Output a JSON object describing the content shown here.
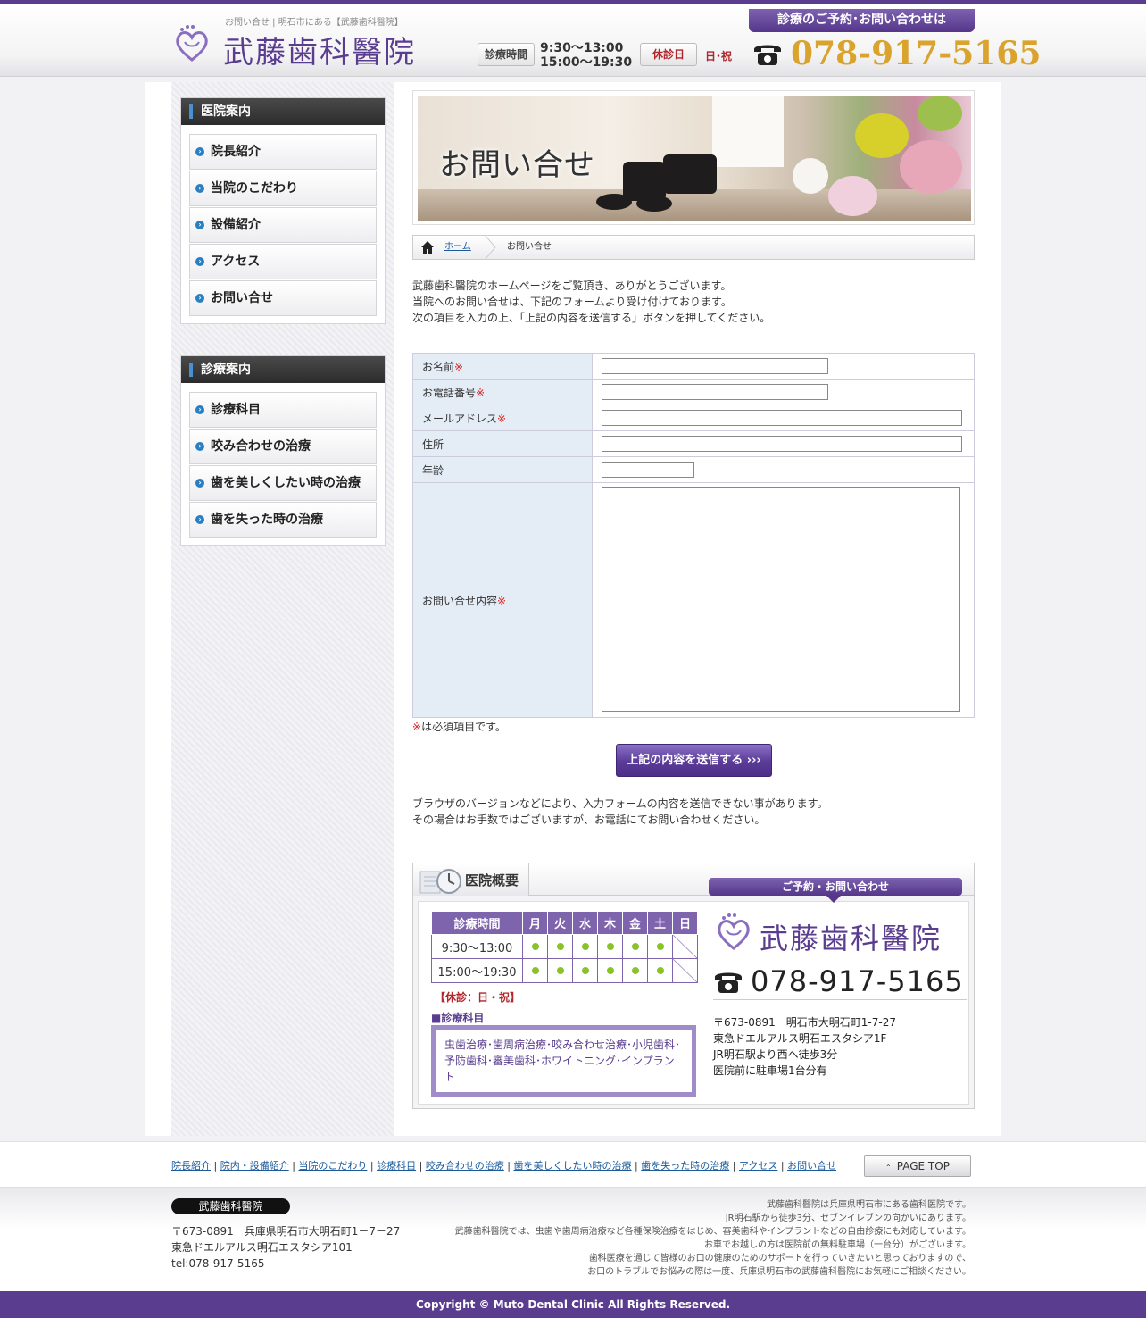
{
  "header": {
    "tagline": "お問い合せ | 明石市にある【武藤歯科醫院】",
    "logo_text": "武藤歯科醫院",
    "hours_label": "診療時間",
    "hours_am": "9:30～13:00",
    "hours_pm": "15:00～19:30",
    "closed_label": "休診日",
    "closed_days": "日･祝",
    "contact_banner": "診療のご予約･お問い合わせは",
    "phone": "078-917-5165"
  },
  "sidebar": {
    "clinic_head": "医院案内",
    "clinic_items": [
      "院長紹介",
      "当院のこだわり",
      "設備紹介",
      "アクセス",
      "お問い合せ"
    ],
    "treat_head": "診療案内",
    "treat_items": [
      "診療科目",
      "咬み合わせの治療",
      "歯を美しくしたい時の治療",
      "歯を失った時の治療"
    ]
  },
  "hero": {
    "title": "お問い合せ"
  },
  "breadcrumb": {
    "home": "ホーム",
    "current": "お問い合せ"
  },
  "intro": {
    "line1": "武藤歯科醫院のホームページをご覧頂き、ありがとうございます。",
    "line2": "当院へのお問い合せは、下記のフォームより受け付けております。",
    "line3": "次の項目を入力の上、「上記の内容を送信する」ボタンを押してください。"
  },
  "form": {
    "required_mark": "※",
    "name_label": "お名前",
    "phone_label": "お電話番号",
    "email_label": "メールアドレス",
    "address_label": "住所",
    "age_label": "年齢",
    "message_label": "お問い合せ内容",
    "required_note": "は必須項目です。",
    "submit_label": "上記の内容を送信する ›››"
  },
  "browser_note": {
    "line1": "ブラウザのバージョンなどにより、入力フォームの内容を送信できない事があります。",
    "line2": "その場合はお手数ではございますが、お電話にてお問い合わせください。"
  },
  "overview": {
    "tab_label": "医院概要",
    "contact_tag": "ご予約・お問い合わせ",
    "schedule_header": [
      "診療時間",
      "月",
      "火",
      "水",
      "木",
      "金",
      "土",
      "日"
    ],
    "slot_am": "9:30～13:00",
    "slot_pm": "15:00～19:30",
    "closed_line": "【休診：日・祝】",
    "dept_head": "■診療科目",
    "dept_text": "虫歯治療･歯周病治療･咬み合わせ治療･小児歯科･予防歯科･審美歯科･ホワイトニング･インプラント",
    "logo_text": "武藤歯科醫院",
    "phone": "078-917-5165",
    "address1": "〒673-0891　明石市大明石町1-7-27",
    "address2": "東急ドエルアルス明石エスタシア1F",
    "address3": "JR明石駅より西へ徒歩3分",
    "address4": "医院前に駐車場1台分有"
  },
  "footer": {
    "links": [
      "院長紹介",
      "院内・設備紹介",
      "当院のこだわり",
      "診療科目",
      "咬み合わせの治療",
      "歯を美しくしたい時の治療",
      "歯を失った時の治療",
      "アクセス",
      "お問い合せ"
    ],
    "pagetop": "PAGE TOP",
    "name": "武藤歯科醫院",
    "addr1": "〒673-0891　兵庫県明石市大明石町1－7－27",
    "addr2": "東急ドエルアルス明石エスタシア101",
    "addr3": "tel:078-917-5165",
    "desc1": "武藤歯科醫院は兵庫県明石市にある歯科医院です。",
    "desc2": "JR明石駅から徒歩3分、セブンイレブンの向かいにあります。",
    "desc3": "武藤歯科醫院では、虫歯や歯周病治療など各種保険治療をはじめ、審美歯科やインプラントなどの自由診療にも対応しています。",
    "desc4": "お車でお越しの方は医院前の無料駐車場（一台分）がございます。",
    "desc5": "歯科医療を通じて皆様のお口の健康のためのサポートを行っていきたいと思っておりますので、",
    "desc6": "お口のトラブルでお悩みの際は一度、兵庫県明石市の武藤歯科醫院にお気軽にご相談ください。",
    "copyright": "Copyright © Muto Dental Clinic All Rights Reserved."
  },
  "colors": {
    "brand": "#5a3d8f",
    "accent": "#d9a32e",
    "alert": "#b0262a"
  }
}
